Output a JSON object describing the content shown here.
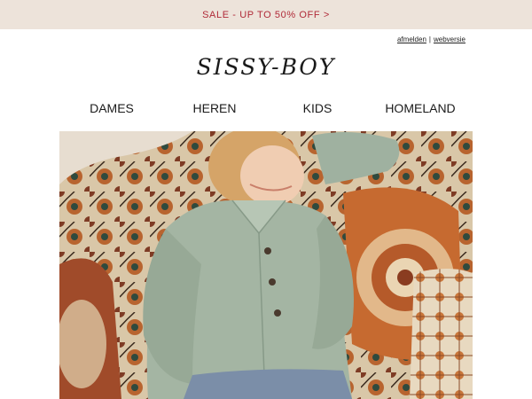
{
  "banner": {
    "text": "SALE - UP TO 50% OFF >",
    "color": "#b02a38",
    "background": "#ede3da"
  },
  "toplinks": {
    "unsubscribe": "afmelden",
    "separator": "|",
    "webversion": "webversie"
  },
  "logo": {
    "text": "SISSY-BOY"
  },
  "nav": {
    "items": [
      "DAMES",
      "HEREN",
      "KIDS",
      "HOMELAND"
    ]
  },
  "hero": {
    "alt": "Woman in sage green shirt jacket lounging on patterned cushions"
  }
}
